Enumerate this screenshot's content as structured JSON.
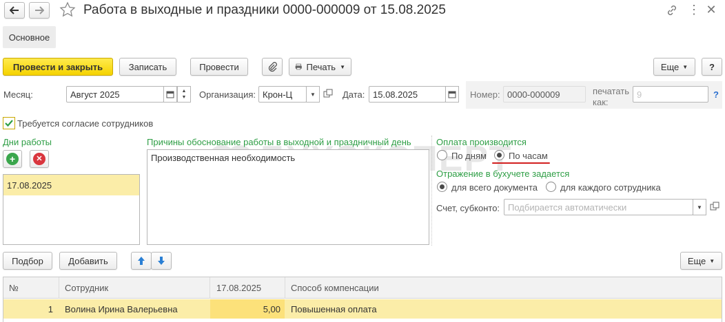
{
  "window": {
    "title": "Работа в выходные и праздники 0000-000009 от 15.08.2025"
  },
  "tabs": {
    "main": "Основное"
  },
  "toolbar": {
    "post_close": "Провести и закрыть",
    "save": "Записать",
    "post": "Провести",
    "print": "Печать",
    "more": "Еще",
    "help": "?"
  },
  "fields": {
    "month_label": "Месяц:",
    "month_value": "Август 2025",
    "org_label": "Организация:",
    "org_value": "Крон-Ц",
    "date_label": "Дата:",
    "date_value": "15.08.2025",
    "number_label": "Номер:",
    "number_value": "0000-000009",
    "print_as_label_1": "печатать",
    "print_as_label_2": "как:",
    "print_as_value": "9",
    "print_as_help": "?"
  },
  "consent": {
    "label": "Требуется согласие сотрудников",
    "checked": true
  },
  "work_days": {
    "title": "Дни работы",
    "items": [
      "17.08.2025"
    ]
  },
  "reasons": {
    "title": "Причины обоснование работы в выходной и праздничный день",
    "text": "Производственная необходимость"
  },
  "payment": {
    "title": "Оплата производится",
    "by_days": "По дням",
    "by_hours": "По часам",
    "selected": "by_hours"
  },
  "accounting": {
    "title": "Отражение в бухучете задается",
    "whole_doc": "для всего документа",
    "per_employee": "для каждого сотрудника",
    "account_label": "Счет, субконто:",
    "account_placeholder": "Подбирается автоматически"
  },
  "table_toolbar": {
    "select": "Подбор",
    "add": "Добавить",
    "more": "Еще"
  },
  "table": {
    "headers": {
      "num": "№",
      "employee": "Сотрудник",
      "date": "17.08.2025",
      "compensation": "Способ компенсации"
    },
    "rows": [
      {
        "num": "1",
        "employee": "Волина Ирина Валерьевна",
        "hours": "5,00",
        "compensation": "Повышенная оплата"
      }
    ]
  },
  "watermark": "БУХЭКСПЕРТ",
  "colors": {
    "accent_green": "#2e9e45",
    "primary_button": "#f5d300",
    "selected_row": "#fbeda8",
    "highlight_cell": "#fce17a",
    "underline_red": "#d21f1f"
  }
}
